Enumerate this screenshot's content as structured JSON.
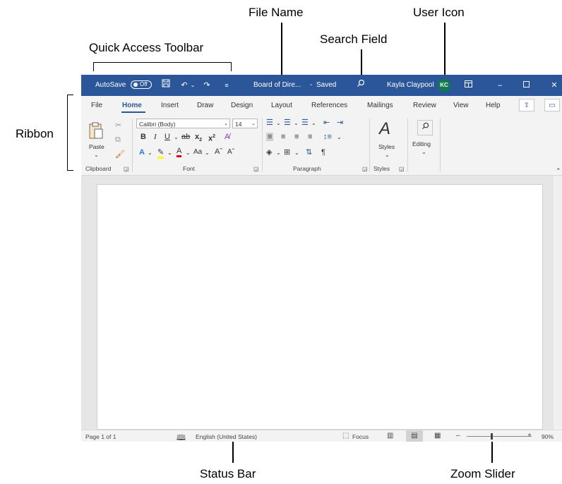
{
  "callouts": {
    "file_name": "File Name",
    "user_icon": "User Icon",
    "search_field": "Search Field",
    "quick_access": "Quick Access Toolbar",
    "ribbon": "Ribbon",
    "status_bar": "Status Bar",
    "zoom_slider": "Zoom Slider"
  },
  "titlebar": {
    "autosave_label": "AutoSave",
    "autosave_state": "Off",
    "document": "Board of Dire...",
    "separator": "-",
    "save_status": "Saved",
    "user_name": "Kayla Claypool",
    "user_initials": "KC",
    "accent_color": "#2b579a"
  },
  "tabs": [
    "File",
    "Home",
    "Insert",
    "Draw",
    "Design",
    "Layout",
    "References",
    "Mailings",
    "Review",
    "View",
    "Help"
  ],
  "ribbon": {
    "clipboard": {
      "paste_label": "Paste",
      "group_label": "Clipboard"
    },
    "font": {
      "font_name": "Calibri (Body)",
      "font_size": "14",
      "group_label": "Font",
      "case_label": "Aa"
    },
    "paragraph": {
      "group_label": "Paragraph"
    },
    "styles": {
      "styles_label": "Styles",
      "group_label": "Styles"
    },
    "editing": {
      "editing_label": "Editing"
    }
  },
  "statusbar": {
    "page": "Page 1 of 1",
    "language": "English (United States)",
    "focus": "Focus",
    "zoom_minus": "–",
    "zoom_plus": "+",
    "zoom_level": "90%"
  }
}
